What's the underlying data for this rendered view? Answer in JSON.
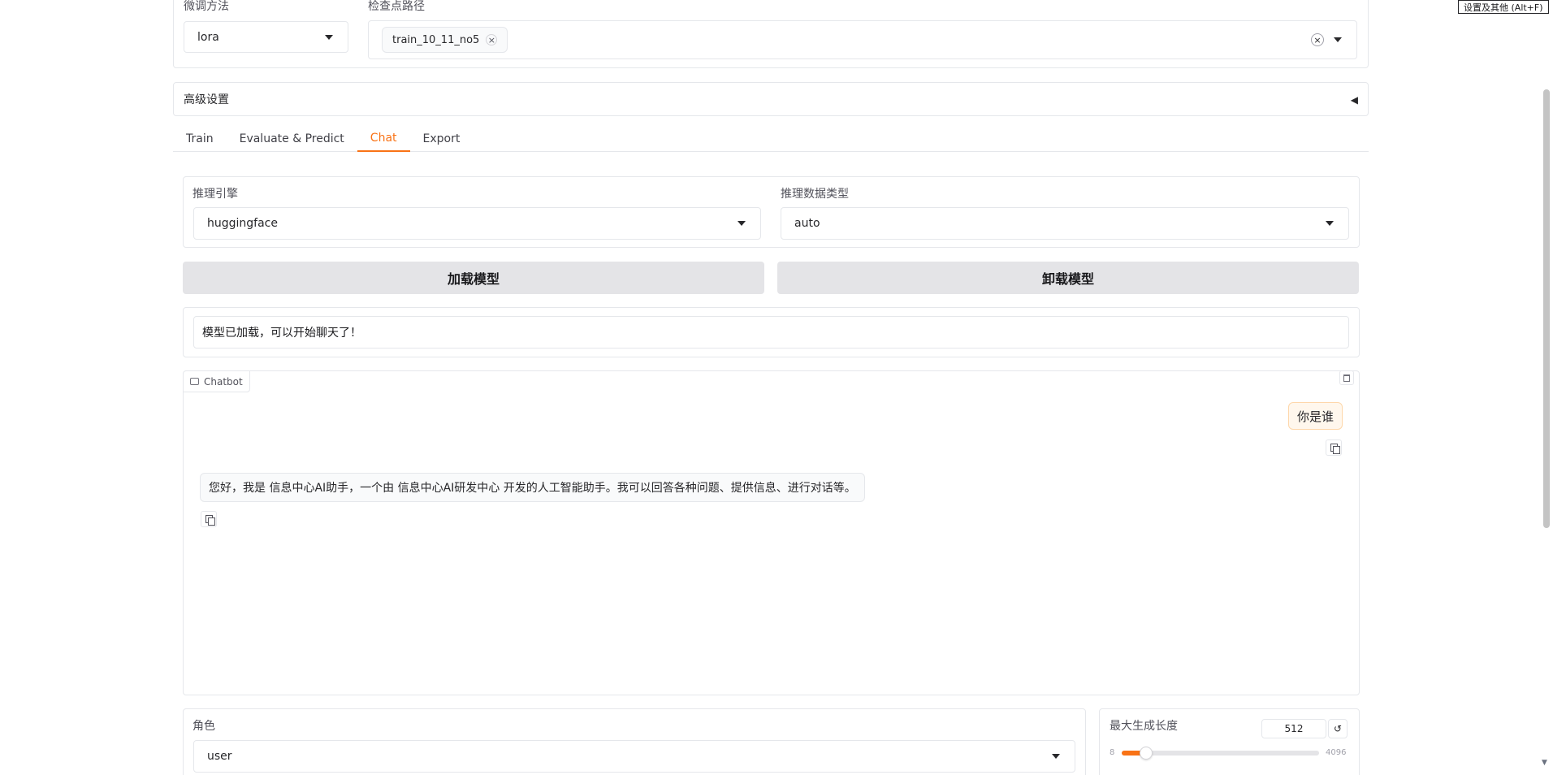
{
  "top": {
    "finetune_label": "微调方法",
    "finetune_value": "lora",
    "checkpoint_label": "检查点路径",
    "checkpoint_token": "train_10_11_no5",
    "token_remove": "×",
    "clear_all": "×"
  },
  "advanced": {
    "title": "高级设置",
    "toggle": "◀"
  },
  "tabs": [
    {
      "label": "Train"
    },
    {
      "label": "Evaluate & Predict"
    },
    {
      "label": "Chat"
    },
    {
      "label": "Export"
    }
  ],
  "active_tab": "Chat",
  "engine": {
    "label": "推理引擎",
    "value": "huggingface"
  },
  "dtype": {
    "label": "推理数据类型",
    "value": "auto"
  },
  "buttons": {
    "load": "加载模型",
    "unload": "卸载模型"
  },
  "status": {
    "text": "模型已加载，可以开始聊天了！"
  },
  "chatbot": {
    "label": "Chatbot",
    "messages": [
      {
        "role": "user",
        "text": "你是谁"
      },
      {
        "role": "assistant",
        "text": "您好，我是 信息中心AI助手，一个由 信息中心AI研发中心 开发的人工智能助手。我可以回答各种问题、提供信息、进行对话等。"
      }
    ]
  },
  "role": {
    "label": "角色",
    "value": "user"
  },
  "max_len": {
    "label": "最大生成长度",
    "value": "512",
    "min": "8",
    "max": "4096",
    "reset": "↺",
    "fill_fraction": 0.124
  },
  "tooltip": "设置及其他 (Alt+F)",
  "scroll_down": "▼"
}
